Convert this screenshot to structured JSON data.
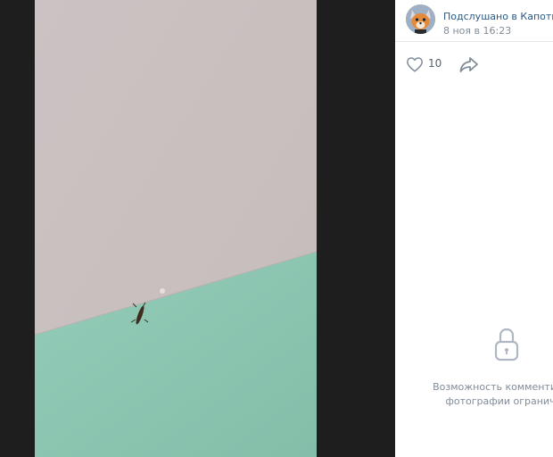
{
  "post": {
    "author": "Подслушано в Капотне",
    "date": "8 ноя в 16:23",
    "likes": "10"
  },
  "comments": {
    "line1": "Возможность комментирова",
    "line2": "фотографии ограничен"
  },
  "icons": {
    "avatar": "fox-avatar",
    "like": "heart-icon",
    "share": "share-arrow-icon",
    "lock": "lock-icon"
  },
  "colors": {
    "link": "#2a5885",
    "muted": "#818c99",
    "wall_top": "#c8c0bf",
    "wall_bottom": "#8fc9b4"
  }
}
